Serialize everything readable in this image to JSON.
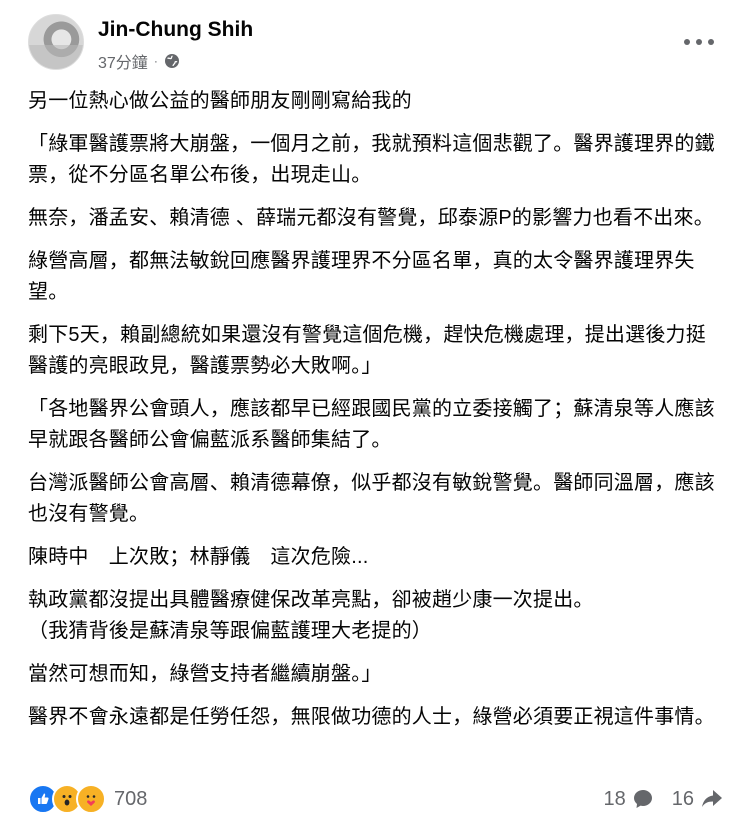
{
  "post": {
    "author": "Jin-Chung Shih",
    "timestamp": "37分鐘",
    "separator": "·",
    "paragraphs": [
      "另一位熱心做公益的醫師朋友剛剛寫給我的",
      "「綠軍醫護票將大崩盤，一個月之前，我就預料這個悲觀了。醫界護理界的鐵票，從不分區名單公布後，出現走山。",
      "無奈，潘孟安、賴清德 、薛瑞元都沒有警覺，邱泰源P的影響力也看不出來。",
      "綠營高層，都無法敏銳回應醫界護理界不分區名單，真的太令醫界護理界失望。",
      "剩下5天，賴副總統如果還沒有警覺這個危機，趕快危機處理，提出選後力挺醫護的亮眼政見，醫護票勢必大敗啊。」",
      "「各地醫界公會頭人，應該都早已經跟國民黨的立委接觸了；蘇清泉等人應該早就跟各醫師公會偏藍派系醫師集結了。",
      "台灣派醫師公會高層、賴清德幕僚，似乎都沒有敏銳警覺。醫師同溫層，應該也沒有警覺。",
      "陳時中　上次敗；林靜儀　這次危險...",
      "執政黨都沒提出具體醫療健保改革亮點，卻被趙少康一次提出。\n（我猜背後是蘇清泉等跟偏藍護理大老提的）",
      "當然可想而知，綠營支持者繼續崩盤。」",
      "醫界不會永遠都是任勞任怨，無限做功德的人士，綠營必須要正視這件事情。"
    ]
  },
  "footer": {
    "reaction_count": "708",
    "comment_count": "18",
    "share_count": "16"
  },
  "icons": {
    "globe": "globe-icon",
    "more": "more-options-icon",
    "like": "like-icon",
    "wow": "wow-icon",
    "care": "care-icon",
    "comment": "comment-icon",
    "share": "share-icon"
  },
  "colors": {
    "like_blue": "#1877f2",
    "reaction_yellow": "#f7b125",
    "meta_gray": "#65676b"
  }
}
